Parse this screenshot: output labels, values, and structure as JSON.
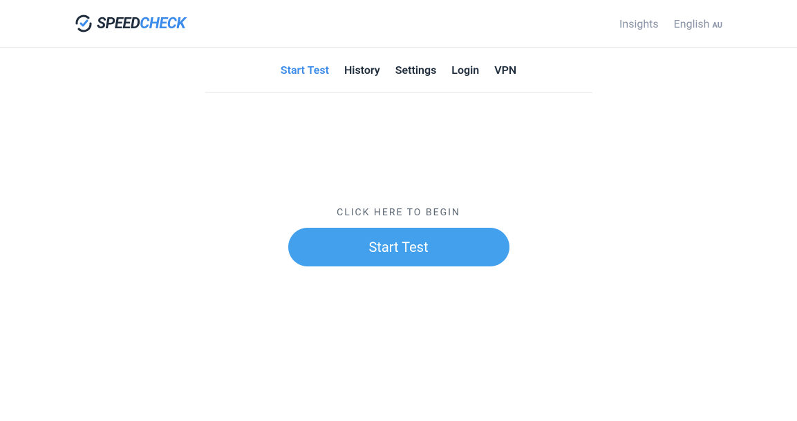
{
  "header": {
    "logo_part1": "SPEED",
    "logo_part2": "CHECK",
    "insights": "Insights",
    "language": "English",
    "language_suffix": "AU"
  },
  "subnav": {
    "start_test": "Start Test",
    "history": "History",
    "settings": "Settings",
    "login": "Login",
    "vpn": "VPN"
  },
  "main": {
    "begin_text": "CLICK HERE TO BEGIN",
    "start_button": "Start Test"
  }
}
